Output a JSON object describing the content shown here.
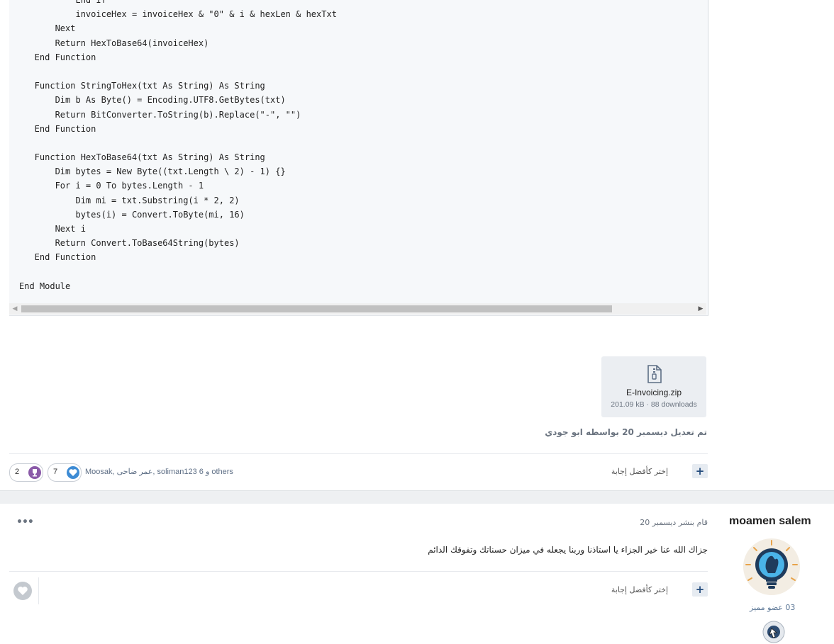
{
  "code": {
    "lines": [
      "           End If",
      "           invoiceHex = invoiceHex & \"0\" & i & hexLen & hexTxt",
      "       Next",
      "       Return HexToBase64(invoiceHex)",
      "   End Function",
      "",
      "   Function StringToHex(txt As String) As String",
      "       Dim b As Byte() = Encoding.UTF8.GetBytes(txt)",
      "       Return BitConverter.ToString(b).Replace(\"-\", \"\")",
      "   End Function",
      "",
      "   Function HexToBase64(txt As String) As String",
      "       Dim bytes = New Byte((txt.Length \\ 2) - 1) {}",
      "       For i = 0 To bytes.Length - 1",
      "           Dim mi = txt.Substring(i * 2, 2)",
      "           bytes(i) = Convert.ToByte(mi, 16)",
      "       Next i",
      "       Return Convert.ToBase64String(bytes)",
      "   End Function",
      "",
      "End Module"
    ],
    "scroll_left_arrow": "◀",
    "scroll_right_arrow": "▶"
  },
  "attachment": {
    "file_name": "E-Invoicing.zip",
    "meta": "201.09 kB · 88 downloads",
    "icon": "zip-file-icon"
  },
  "edited_note": "تم تعديل ديسمبر 20 بواسطه ابو جودي",
  "post1_footer": {
    "best_answer_label": "إختر كأفضل إجابة",
    "plus_symbol": "+",
    "reacted_by": "Moosak, عمر ضاحى, soliman123 و 6 others",
    "like_count": "7",
    "trophy_count": "2"
  },
  "post2": {
    "author": "moamen salem",
    "rank": "عضو مميز",
    "post_count": "03",
    "posted_on": "قام بنشر ديسمبر 20",
    "body": "جزاك الله عنا خير الجزاء يا استاذنا وربنا يجعله في ميزان حسناتك وتفوقك الدائم",
    "best_answer_label": "إختر كأفضل إجابة",
    "plus_symbol": "+",
    "more_symbol": "•••"
  },
  "colors": {
    "code_bg": "#f6f8fa",
    "accent": "#244c7d",
    "like_blue": "#3d8bd4",
    "trophy_purple": "#8a5aa8"
  }
}
